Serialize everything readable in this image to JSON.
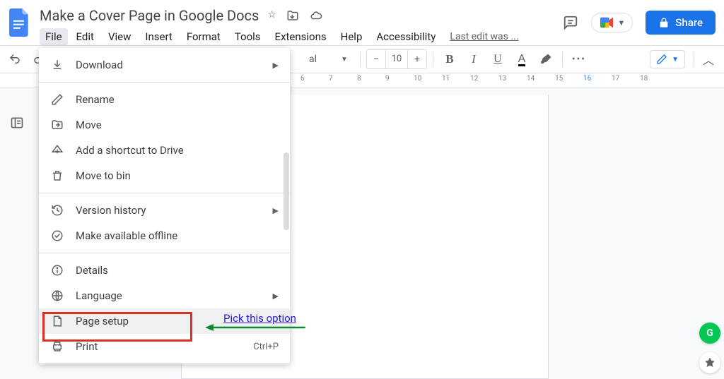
{
  "title": "Make a Cover Page in Google Docs",
  "menubar": {
    "file": "File",
    "edit": "Edit",
    "view": "View",
    "insert": "Insert",
    "format": "Format",
    "tools": "Tools",
    "extensions": "Extensions",
    "help": "Help",
    "accessibility": "Accessibility",
    "last_edit": "Last edit was ..."
  },
  "header_actions": {
    "share": "Share"
  },
  "toolbar": {
    "font_name_partial": "al",
    "font_size": "10",
    "bold": "B",
    "italic": "I",
    "underline": "U",
    "text_color": "A"
  },
  "ruler": {
    "ticks": [
      "6",
      "7",
      "8",
      "9",
      "10",
      "11",
      "12",
      "13",
      "14",
      "15",
      "16",
      "17",
      "18"
    ]
  },
  "file_menu": {
    "download": "Download",
    "rename": "Rename",
    "move": "Move",
    "add_shortcut": "Add a shortcut to Drive",
    "move_to_bin": "Move to bin",
    "version_history": "Version history",
    "make_offline": "Make available offline",
    "details": "Details",
    "language": "Language",
    "page_setup": "Page setup",
    "print": "Print",
    "print_shortcut": "Ctrl+P"
  },
  "annotation": {
    "text": "Pick this option"
  }
}
